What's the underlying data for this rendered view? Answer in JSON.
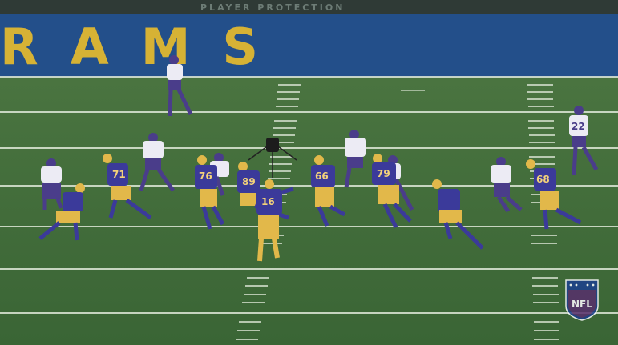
{
  "scene": {
    "end_zone_lettering": "RAMS",
    "wall_lettering": "PLAYER PROTECTION"
  },
  "players": [
    {
      "number": "76"
    },
    {
      "number": "16"
    },
    {
      "number": "66"
    },
    {
      "number": "79"
    },
    {
      "number": "71"
    },
    {
      "number": "22"
    },
    {
      "number": "89"
    },
    {
      "number": "68"
    }
  ],
  "network_logo": {
    "text": "NFL",
    "colors": {
      "blue": "#1c3f8f",
      "red": "#c8102e",
      "white": "#ffffff"
    }
  },
  "colors": {
    "turf": "#3f6a3a",
    "end_zone": "#234f8a",
    "gold": "#d6b235",
    "rams_jersey": "#3b3a9a",
    "rams_pants": "#e2b84a",
    "vikings_jersey": "#ecebf4",
    "vikings_pants": "#4a3d8a"
  }
}
